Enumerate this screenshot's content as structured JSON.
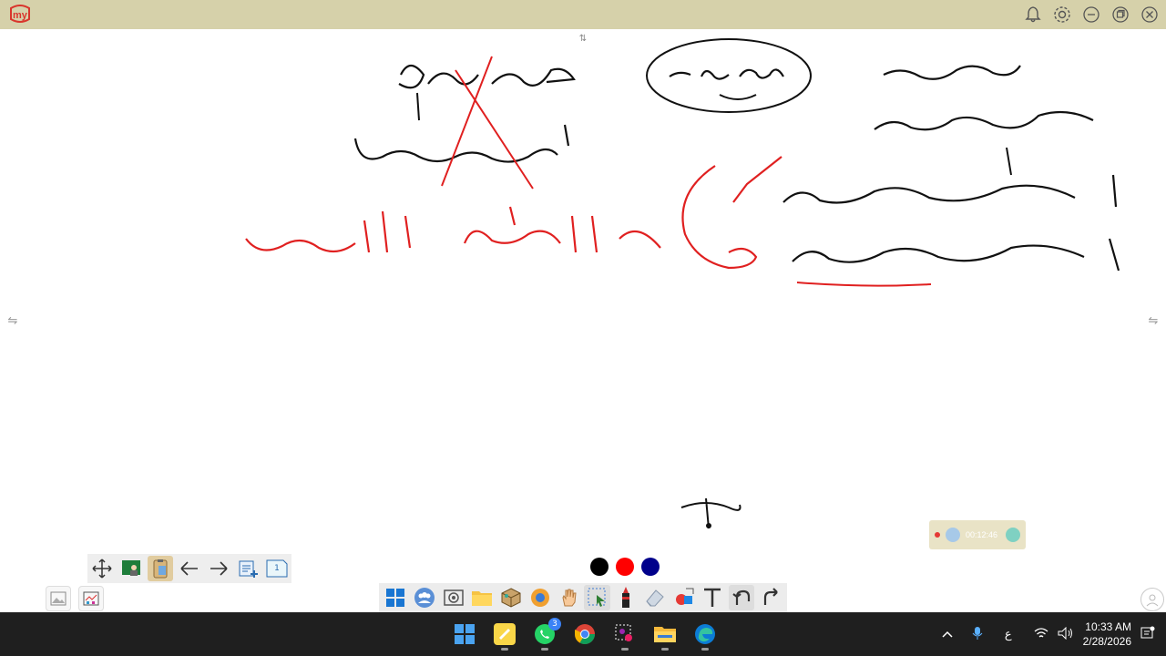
{
  "app": {
    "logo_text": "my"
  },
  "recorder": {
    "time": "00:12:46"
  },
  "pen_colors": [
    "#000000",
    "#ff0000",
    "#00008b"
  ],
  "page_counter": "1",
  "taskbar": {
    "whatsapp_badge": "3",
    "input_language": "ع",
    "time": "10:33 AM",
    "date": "2/28/2026"
  },
  "colors": {
    "titlebar": "#d6d1aa",
    "taskbar": "#1f1f1f",
    "ink_red": "#e02020"
  }
}
